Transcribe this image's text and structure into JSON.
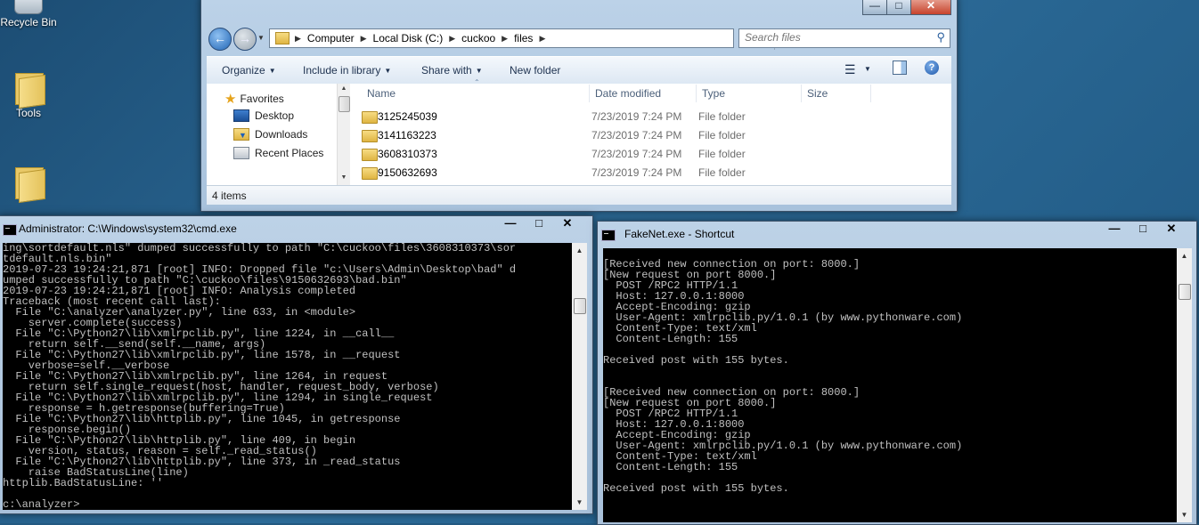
{
  "desktop": {
    "icons": [
      {
        "label": "Recycle Bin"
      },
      {
        "label": "Tools"
      }
    ]
  },
  "explorer": {
    "address": {
      "crumbs": [
        "Computer",
        "Local Disk (C:)",
        "cuckoo",
        "files"
      ]
    },
    "search": {
      "placeholder": "Search files"
    },
    "toolbar": {
      "organize": "Organize",
      "include_in_library": "Include in library",
      "share_with": "Share with",
      "new_folder": "New folder"
    },
    "nav_pane": {
      "favorites": "Favorites",
      "items": [
        "Desktop",
        "Downloads",
        "Recent Places"
      ]
    },
    "columns": [
      "Name",
      "Date modified",
      "Type",
      "Size"
    ],
    "files": [
      {
        "name": "3125245039",
        "date": "7/23/2019 7:24 PM",
        "type": "File folder",
        "size": ""
      },
      {
        "name": "3141163223",
        "date": "7/23/2019 7:24 PM",
        "type": "File folder",
        "size": ""
      },
      {
        "name": "3608310373",
        "date": "7/23/2019 7:24 PM",
        "type": "File folder",
        "size": ""
      },
      {
        "name": "9150632693",
        "date": "7/23/2019 7:24 PM",
        "type": "File folder",
        "size": ""
      }
    ],
    "status": "4 items"
  },
  "cmd": {
    "title": "Administrator: C:\\Windows\\system32\\cmd.exe",
    "lines": [
      "ing\\sortdefault.nls\" dumped successfully to path \"C:\\cuckoo\\files\\3608310373\\sor",
      "tdefault.nls.bin\"",
      "2019-07-23 19:24:21,871 [root] INFO: Dropped file \"c:\\Users\\Admin\\Desktop\\bad\" d",
      "umped successfully to path \"C:\\cuckoo\\files\\9150632693\\bad.bin\"",
      "2019-07-23 19:24:21,871 [root] INFO: Analysis completed",
      "Traceback (most recent call last):",
      "  File \"C:\\analyzer\\analyzer.py\", line 633, in <module>",
      "    server.complete(success)",
      "  File \"C:\\Python27\\lib\\xmlrpclib.py\", line 1224, in __call__",
      "    return self.__send(self.__name, args)",
      "  File \"C:\\Python27\\lib\\xmlrpclib.py\", line 1578, in __request",
      "    verbose=self.__verbose",
      "  File \"C:\\Python27\\lib\\xmlrpclib.py\", line 1264, in request",
      "    return self.single_request(host, handler, request_body, verbose)",
      "  File \"C:\\Python27\\lib\\xmlrpclib.py\", line 1294, in single_request",
      "    response = h.getresponse(buffering=True)",
      "  File \"C:\\Python27\\lib\\httplib.py\", line 1045, in getresponse",
      "    response.begin()",
      "  File \"C:\\Python27\\lib\\httplib.py\", line 409, in begin",
      "    version, status, reason = self._read_status()",
      "  File \"C:\\Python27\\lib\\httplib.py\", line 373, in _read_status",
      "    raise BadStatusLine(line)",
      "httplib.BadStatusLine: ''",
      "",
      "c:\\analyzer>"
    ]
  },
  "fakenet": {
    "title": "FakeNet.exe - Shortcut",
    "lines": [
      "",
      "[Received new connection on port: 8000.]",
      "[New request on port 8000.]",
      "  POST /RPC2 HTTP/1.1",
      "  Host: 127.0.0.1:8000",
      "  Accept-Encoding: gzip",
      "  User-Agent: xmlrpclib.py/1.0.1 (by www.pythonware.com)",
      "  Content-Type: text/xml",
      "  Content-Length: 155",
      "",
      "Received post with 155 bytes.",
      "",
      "",
      "[Received new connection on port: 8000.]",
      "[New request on port 8000.]",
      "  POST /RPC2 HTTP/1.1",
      "  Host: 127.0.0.1:8000",
      "  Accept-Encoding: gzip",
      "  User-Agent: xmlrpclib.py/1.0.1 (by www.pythonware.com)",
      "  Content-Type: text/xml",
      "  Content-Length: 155",
      "",
      "Received post with 155 bytes."
    ]
  }
}
